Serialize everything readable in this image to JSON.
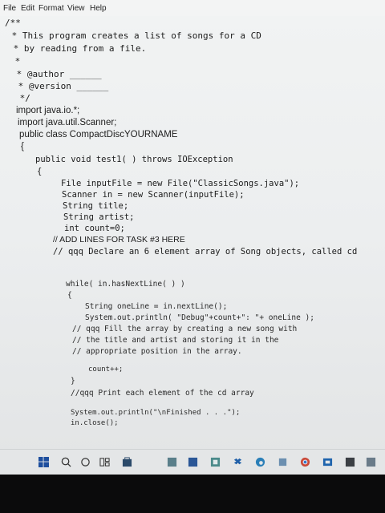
{
  "menu": {
    "file": "File",
    "edit": "Edit",
    "format": "Format",
    "view": "View",
    "help": "Help"
  },
  "code": {
    "line1": "/**",
    "line2": " * This program creates a list of songs for a CD",
    "line3": " * by reading from a file.",
    "line4": " *",
    "line5": " * @author ______",
    "line6": " * @version ______",
    "line7": " */",
    "line8": "import java.io.*;",
    "line9": "import java.util.Scanner;",
    "line10": "public class CompactDiscYOURNAME",
    "line11": "{",
    "line12": "public void test1( ) throws IOException",
    "line13": "{",
    "line14": "File inputFile = new File(\"ClassicSongs.java\");",
    "line15": "Scanner in = new Scanner(inputFile);",
    "line16": "String title;",
    "line17": "String artist;",
    "line18": "int count=0;",
    "line19": "// ADD LINES FOR TASK #3 HERE",
    "line20": "// qqq Declare an 6 element array of Song objects, called cd",
    "line21": "while( in.hasNextLine( ) )",
    "line22": "{",
    "line23": "String oneLine = in.nextLine();",
    "line24": "System.out.println( \"Debug\"+count+\": \"+ oneLine );",
    "line25": "// qqq Fill the array by creating a new song with",
    "line26": "// the title and artist and storing it in the",
    "line27": "// appropriate position in the array.",
    "line28": "count++;",
    "line29": "}",
    "line30": "//qqq Print each element of the cd array",
    "line31": "System.out.println(\"\\nFinished . . .\");",
    "line32": "in.close();"
  },
  "taskbar": {
    "icons": [
      "windows-start-icon",
      "search-icon",
      "task-view-icon",
      "snap-icon",
      "store-icon",
      "photos-icon",
      "word-icon",
      "app-icon",
      "dropbox-icon",
      "edge-icon",
      "app2-icon",
      "chrome-icon",
      "outlook-icon",
      "app3-icon",
      "photos2-icon"
    ]
  },
  "colors": {
    "editor_bg": "#eceeef",
    "text": "#1c1c1c",
    "taskbar_bg": "#e4e6e7"
  }
}
